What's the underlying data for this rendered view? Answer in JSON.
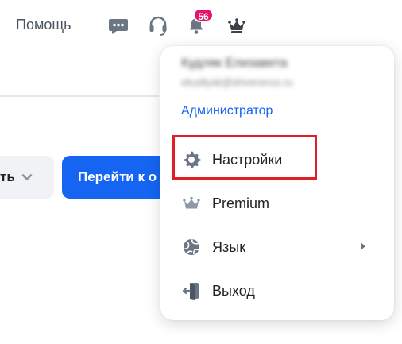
{
  "topbar": {
    "help_label": "Помощь",
    "icons": [
      "chat-icon",
      "support-headset-icon",
      "notifications-bell-icon",
      "crown-icon"
    ],
    "notifications_count": "56"
  },
  "page": {
    "dropdown_label": "ть",
    "primary_button_label": "Перейти к о"
  },
  "menu": {
    "user_name": "Кудляк Елизавета",
    "user_email": "ekudlyak@drivenerus.ru",
    "role": "Администратор",
    "items": [
      {
        "label": "Настройки",
        "icon": "gear-icon"
      },
      {
        "label": "Premium",
        "icon": "crown-icon"
      },
      {
        "label": "Язык",
        "icon": "globe-icon"
      },
      {
        "label": "Выход",
        "icon": "logout-icon"
      }
    ]
  },
  "colors": {
    "accent": "#1565f2",
    "badge": "#e6136d",
    "highlight": "#e11f26",
    "icon_gray": "#6b7583"
  }
}
